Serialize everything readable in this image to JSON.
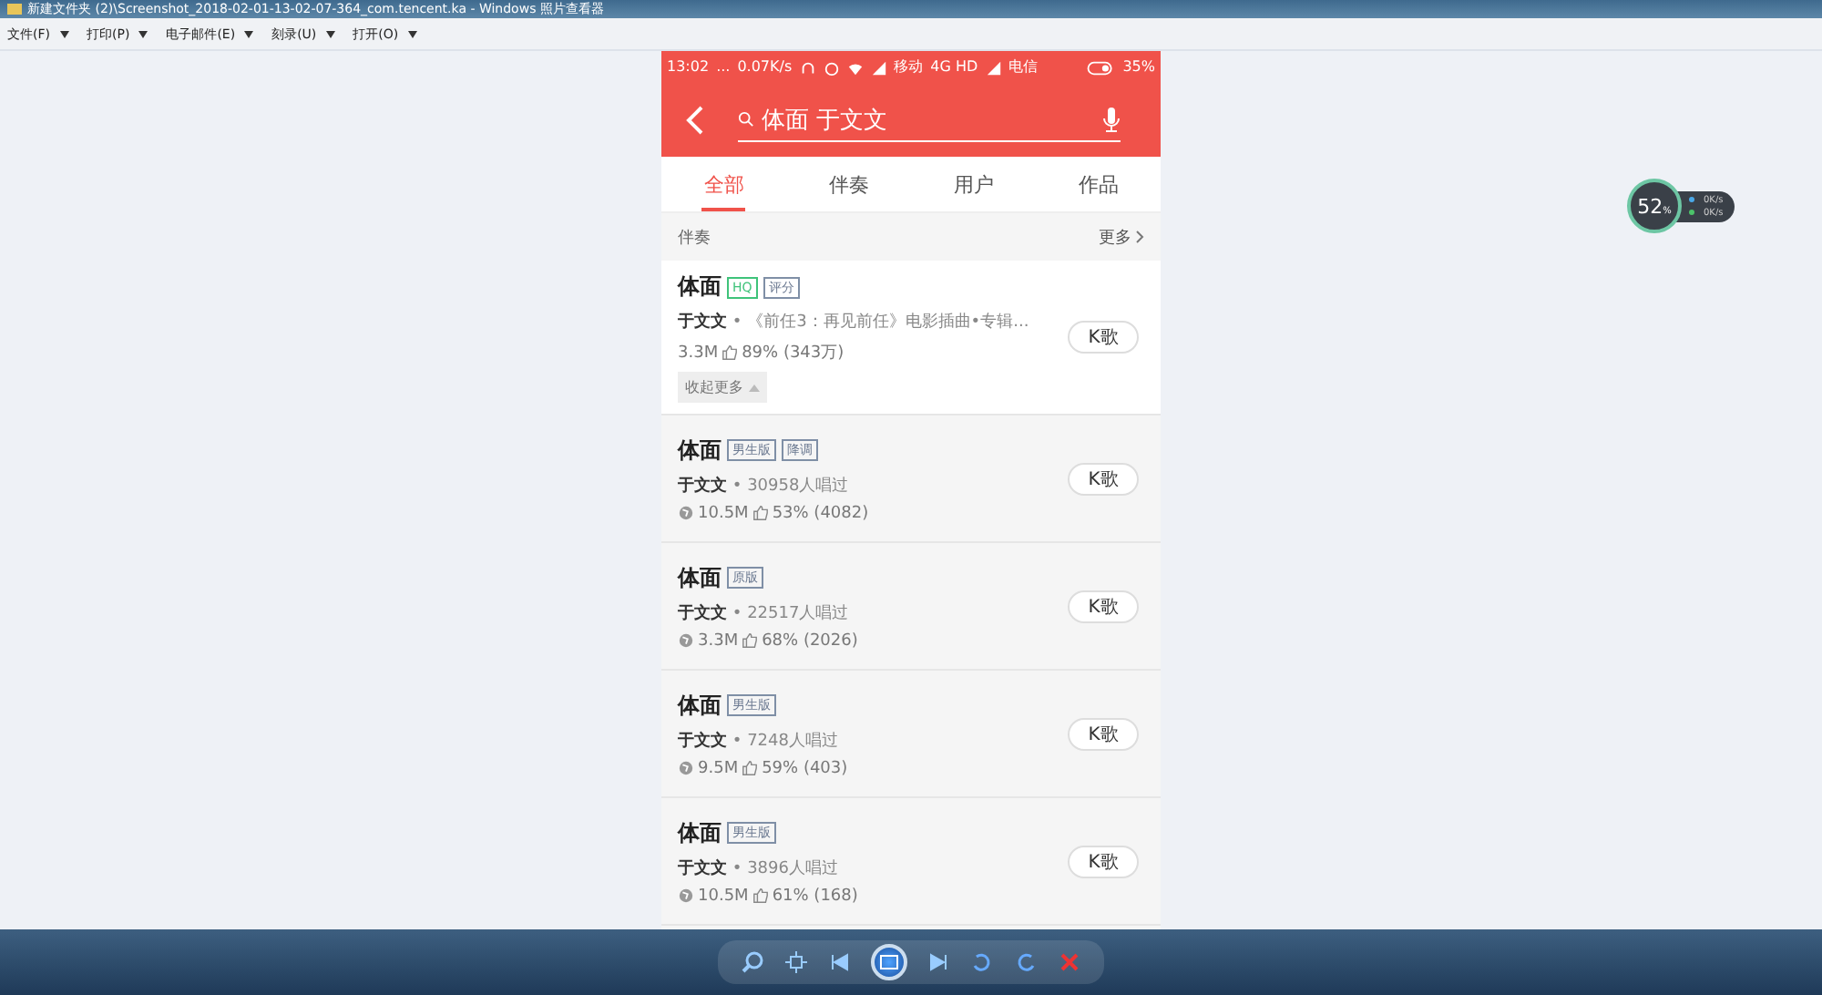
{
  "window": {
    "title": "新建文件夹 (2)\\Screenshot_2018-02-01-13-02-07-364_com.tencent.ka - Windows 照片查看器"
  },
  "menu": [
    {
      "label": "文件(F)"
    },
    {
      "label": "打印(P)"
    },
    {
      "label": "电子邮件(E)"
    },
    {
      "label": "刻录(U)"
    },
    {
      "label": "打开(O)"
    }
  ],
  "phone": {
    "status_bar": {
      "time": "13:02",
      "dots": "...",
      "speed": "0.07K/s",
      "carrier_1": "移动",
      "network": "4G HD",
      "carrier_2": "电信",
      "battery": "35%"
    },
    "search": {
      "value": "体面 于文文"
    },
    "tabs": [
      {
        "label": "全部",
        "selected": true
      },
      {
        "label": "伴奏",
        "selected": false
      },
      {
        "label": "用户",
        "selected": false
      },
      {
        "label": "作品",
        "selected": false
      }
    ],
    "section": {
      "title": "伴奏",
      "more": "更多"
    },
    "results": [
      {
        "kind": "featured",
        "title": "体面",
        "tags": [
          {
            "label": "HQ",
            "kind": "hq"
          },
          {
            "label": "评分",
            "kind": "plain"
          }
        ],
        "artist": "于文文",
        "separator": "•",
        "detail": "《前任3：再见前任》电影插曲•专辑...",
        "globe": false,
        "plays": "3.3M",
        "likes": "89% (343万)",
        "collapse": "收起更多",
        "button": "K歌"
      },
      {
        "kind": "normal",
        "title": "体面",
        "tags": [
          {
            "label": "男生版",
            "kind": "plain"
          },
          {
            "label": "降调",
            "kind": "plain"
          }
        ],
        "artist": "于文文",
        "separator": "•",
        "detail": "30958人唱过",
        "globe": true,
        "plays": "10.5M",
        "likes": "53% (4082)",
        "button": "K歌"
      },
      {
        "kind": "normal",
        "title": "体面",
        "tags": [
          {
            "label": "原版",
            "kind": "plain"
          }
        ],
        "artist": "于文文",
        "separator": "•",
        "detail": "22517人唱过",
        "globe": true,
        "plays": "3.3M",
        "likes": "68% (2026)",
        "button": "K歌"
      },
      {
        "kind": "normal",
        "title": "体面",
        "tags": [
          {
            "label": "男生版",
            "kind": "plain"
          }
        ],
        "artist": "于文文",
        "separator": "•",
        "detail": "7248人唱过",
        "globe": true,
        "plays": "9.5M",
        "likes": "59% (403)",
        "button": "K歌"
      },
      {
        "kind": "normal",
        "title": "体面",
        "tags": [
          {
            "label": "男生版",
            "kind": "plain"
          }
        ],
        "artist": "于文文",
        "separator": "•",
        "detail": "3896人唱过",
        "globe": true,
        "plays": "10.5M",
        "likes": "61% (168)",
        "button": "K歌"
      }
    ]
  },
  "widget": {
    "value": "52",
    "unit": "%",
    "upload": "0K/s",
    "download": "0K/s"
  }
}
